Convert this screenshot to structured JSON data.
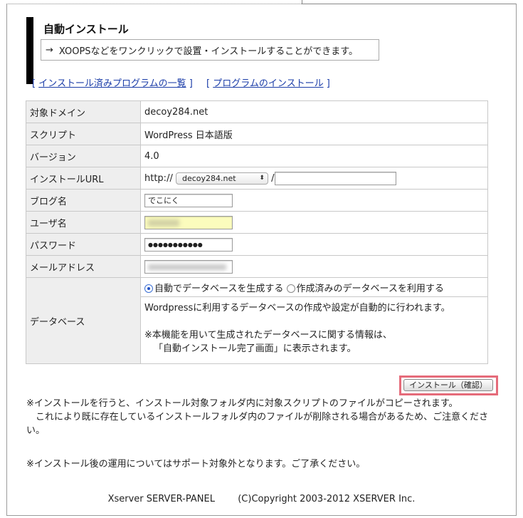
{
  "header": {
    "title": "自動インストール",
    "arrow": "→",
    "description": "XOOPSなどをワンクリックで設置・インストールすることができます。"
  },
  "links": [
    {
      "open": "[",
      "label": "インストール済みプログラムの一覧",
      "close": "]"
    },
    {
      "open": "[",
      "label": "プログラムのインストール",
      "close": "]"
    }
  ],
  "form": {
    "domain": {
      "label": "対象ドメイン",
      "value": "decoy284.net"
    },
    "script": {
      "label": "スクリプト",
      "value": "WordPress 日本語版"
    },
    "version": {
      "label": "バージョン",
      "value": "4.0"
    },
    "install_url": {
      "label": "インストールURL",
      "prefix": "http://",
      "selected_domain": "decoy284.net",
      "separator": "/",
      "path": ""
    },
    "blog_name": {
      "label": "ブログ名",
      "value": "でこにく"
    },
    "username": {
      "label": "ユーザ名"
    },
    "password": {
      "label": "パスワード",
      "value": "●●●●●●●●●●●"
    },
    "email": {
      "label": "メールアドレス"
    },
    "database": {
      "label": "データベース",
      "option_auto": "自動でデータベースを生成する",
      "option_existing": "作成済みのデータベースを利用する",
      "selected": "auto",
      "info": "Wordpressに利用するデータベースの作成や設定が自動的に行われます。",
      "note_line1": "※本機能を用いて生成されたデータベースに関する情報は、",
      "note_line2": "「自動インストール完了画面」に表示されます。"
    }
  },
  "submit_label": "インストール（確認）",
  "notes": {
    "line1": "※インストールを行うと、インストール対象フォルダ内に対象スクリプトのファイルがコピーされます。",
    "line2": "　これにより既に存在しているインストールフォルダ内のファイルが削除される場合があるため、ご注意ください。",
    "line3": "※インストール後の運用についてはサポート対象外となります。ご了承ください。"
  },
  "footer": {
    "brand": "Xserver SERVER-PANEL",
    "copyright": "(C)Copyright 2003-2012 XSERVER Inc."
  },
  "colors": {
    "link": "#1a3ca8",
    "label_bg": "#eeeeee",
    "highlight": "#e56b7a",
    "autofill_yellow": "#fbfcbd"
  }
}
